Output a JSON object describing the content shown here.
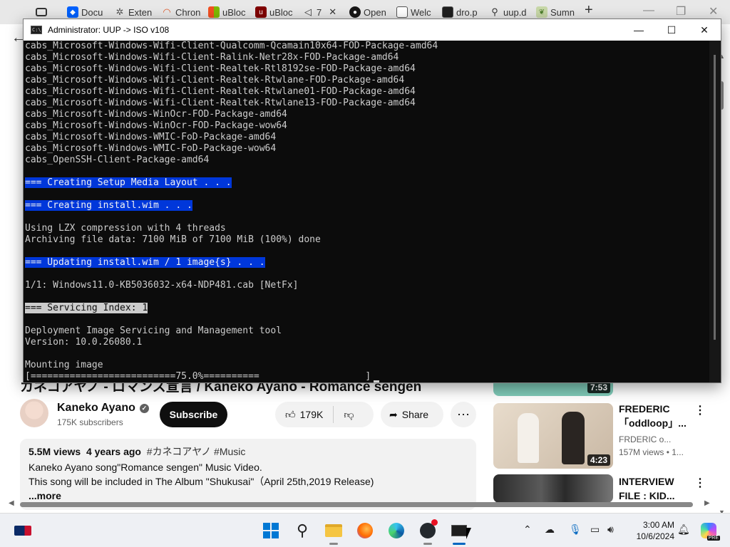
{
  "browser": {
    "tabs": [
      {
        "label": "",
        "icon": "tab-actions-icon",
        "color": "#333333"
      },
      {
        "label": "Docu",
        "icon": "dropbox-icon",
        "color": "#0061fe"
      },
      {
        "label": "Exten",
        "icon": "puzzle-icon",
        "color": "#555555"
      },
      {
        "label": "Chron",
        "icon": "rainbow-icon",
        "color": "#e05a2a"
      },
      {
        "label": "uBloc",
        "icon": "windows-logo-icon",
        "color": "#f25022"
      },
      {
        "label": "uBloc",
        "icon": "ublock-shield-icon",
        "color": "#800000"
      },
      {
        "label": "7",
        "icon": "speaker-icon",
        "color": "#333333"
      },
      {
        "label": "Open",
        "icon": "github-icon",
        "color": "#181717"
      },
      {
        "label": "Welc",
        "icon": "document-icon",
        "color": "#555555"
      },
      {
        "label": "dro.p",
        "icon": "terminal-icon",
        "color": "#1e1e1e"
      },
      {
        "label": "uup.d",
        "icon": "search-icon",
        "color": "#333333"
      },
      {
        "label": "Sumn",
        "icon": "leaf-icon",
        "color": "#4a7c2a"
      }
    ],
    "new_tab": "+",
    "minimize": "—",
    "maximize": "❐",
    "close": "✕",
    "back": "←"
  },
  "console": {
    "title": "Administrator:  UUP -> ISO v108",
    "icon_text": "C:\\",
    "minimize": "—",
    "maximize": "☐",
    "close": "✕",
    "lines": [
      {
        "text": "cabs_Microsoft-Windows-Wifi-Client-Qualcomm-Qcamain10x64-FOD-Package-amd64",
        "style": ""
      },
      {
        "text": "cabs_Microsoft-Windows-Wifi-Client-Ralink-Netr28x-FOD-Package-amd64",
        "style": ""
      },
      {
        "text": "cabs_Microsoft-Windows-Wifi-Client-Realtek-Rtl8192se-FOD-Package-amd64",
        "style": ""
      },
      {
        "text": "cabs_Microsoft-Windows-Wifi-Client-Realtek-Rtwlane-FOD-Package-amd64",
        "style": ""
      },
      {
        "text": "cabs_Microsoft-Windows-Wifi-Client-Realtek-Rtwlane01-FOD-Package-amd64",
        "style": ""
      },
      {
        "text": "cabs_Microsoft-Windows-Wifi-Client-Realtek-Rtwlane13-FOD-Package-amd64",
        "style": ""
      },
      {
        "text": "cabs_Microsoft-Windows-WinOcr-FOD-Package-amd64",
        "style": ""
      },
      {
        "text": "cabs_Microsoft-Windows-WinOcr-FOD-Package-wow64",
        "style": ""
      },
      {
        "text": "cabs_Microsoft-Windows-WMIC-FoD-Package-amd64",
        "style": ""
      },
      {
        "text": "cabs_Microsoft-Windows-WMIC-FoD-Package-wow64",
        "style": ""
      },
      {
        "text": "cabs_OpenSSH-Client-Package-amd64",
        "style": ""
      },
      {
        "text": "",
        "style": ""
      },
      {
        "text": "=== Creating Setup Media Layout . . .",
        "style": "blue"
      },
      {
        "text": "",
        "style": ""
      },
      {
        "text": "=== Creating install.wim . . .",
        "style": "blue"
      },
      {
        "text": "",
        "style": ""
      },
      {
        "text": "Using LZX compression with 4 threads",
        "style": ""
      },
      {
        "text": "Archiving file data: 7100 MiB of 7100 MiB (100%) done",
        "style": ""
      },
      {
        "text": "",
        "style": ""
      },
      {
        "text": "=== Updating install.wim / 1 image{s} . . .",
        "style": "blue"
      },
      {
        "text": "",
        "style": ""
      },
      {
        "text": "1/1: Windows11.0-KB5036032-x64-NDP481.cab [NetFx]",
        "style": ""
      },
      {
        "text": "",
        "style": ""
      },
      {
        "text": "=== Servicing Index: 1",
        "style": "gray"
      },
      {
        "text": "",
        "style": ""
      },
      {
        "text": "Deployment Image Servicing and Management tool",
        "style": ""
      },
      {
        "text": "Version: 10.0.26080.1",
        "style": ""
      },
      {
        "text": "",
        "style": ""
      },
      {
        "text": "Mounting image",
        "style": ""
      },
      {
        "text": "[==========================75.0%==========                   ]",
        "style": ""
      }
    ],
    "highlight_colors": {
      "blue": "#0037da",
      "gray": "#cccccc"
    }
  },
  "video": {
    "title": "カネコアヤノ - ロマンス宣言 / Kaneko Ayano - Romance sengen",
    "channel": "Kaneko Ayano",
    "subscribers": "175K subscribers",
    "subscribe": "Subscribe",
    "likes": "179K",
    "share": "Share",
    "more": "⋯",
    "views": "5.5M views",
    "age": "4 years ago",
    "tags": "#カネコアヤノ #Music",
    "desc_line1": "Kaneko Ayano song\"Romance sengen\" Music Video.",
    "desc_line2": "This song will be included in The Album \"Shukusai\"（April 25th,2019 Release)",
    "desc_more": "...more"
  },
  "recommendations": [
    {
      "title_line1": "",
      "title_line2": "",
      "channel": "",
      "stats": "",
      "duration": "7:53",
      "thumb_color": "#7fcab8"
    },
    {
      "title_line1": "FREDERIC",
      "title_line2": "「oddloop」...",
      "channel": "FRDERIC o...",
      "stats": "157M views • 1...",
      "duration": "4:23",
      "thumb_color": "#d9c9b6"
    },
    {
      "title_line1": "INTERVIEW",
      "title_line2": "FILE : KID...",
      "channel": "",
      "stats": "",
      "duration": "",
      "thumb_color": "#3a3a3a"
    }
  ],
  "taskbar": {
    "time": "3:00 AM",
    "date": "10/6/2024",
    "tray_badge": "PRE"
  }
}
